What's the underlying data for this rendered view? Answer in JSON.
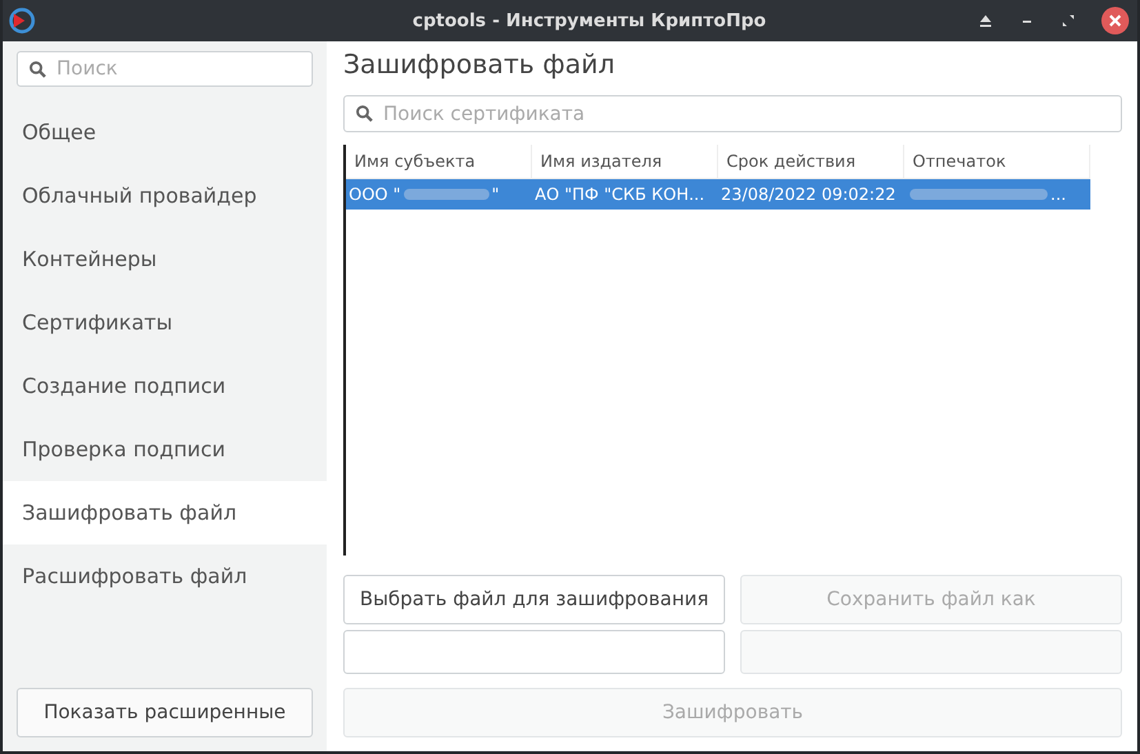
{
  "window": {
    "title": "cptools - Инструменты КриптоПро"
  },
  "sidebar": {
    "search": {
      "placeholder": "Поиск"
    },
    "items": [
      {
        "label": "Общее",
        "selected": false
      },
      {
        "label": "Облачный провайдер",
        "selected": false
      },
      {
        "label": "Контейнеры",
        "selected": false
      },
      {
        "label": "Сертификаты",
        "selected": false
      },
      {
        "label": "Создание подписи",
        "selected": false
      },
      {
        "label": "Проверка подписи",
        "selected": false
      },
      {
        "label": "Зашифровать файл",
        "selected": true
      },
      {
        "label": "Расшифровать файл",
        "selected": false
      }
    ],
    "show_advanced_button": "Показать расширенные"
  },
  "page": {
    "title": "Зашифровать файл",
    "search": {
      "placeholder": "Поиск сертификата"
    },
    "table": {
      "columns": [
        "Имя субъекта",
        "Имя издателя",
        "Срок действия",
        "Отпечаток"
      ],
      "rows": [
        {
          "selected": true,
          "cells": [
            {
              "kind": "blurred",
              "before": "ООО \"",
              "after": "\""
            },
            {
              "kind": "text",
              "text": "АО \"ПФ \"СКБ КОН..."
            },
            {
              "kind": "text",
              "text": "23/08/2022 09:02:22"
            },
            {
              "kind": "blurred",
              "after": "..."
            }
          ]
        }
      ]
    },
    "choose_button": {
      "label": "Выбрать файл для зашифрования",
      "disabled": false
    },
    "save_button": {
      "label": "Сохранить файл как",
      "disabled": true
    },
    "input_field": {
      "disabled": false
    },
    "output_field": {
      "disabled": true
    },
    "encrypt_button": {
      "label": "Зашифровать",
      "disabled": true
    }
  }
}
